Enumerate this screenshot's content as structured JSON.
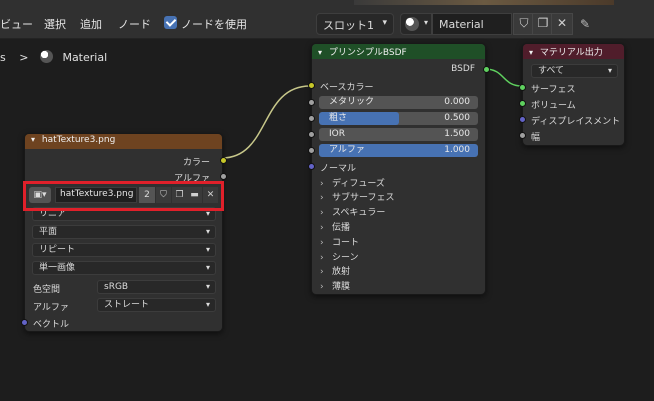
{
  "menu": {
    "view": "ビュー",
    "select": "選択",
    "add": "追加",
    "node": "ノード",
    "use_nodes": "ノードを使用"
  },
  "header": {
    "slot": "スロット1",
    "material_name": "Material",
    "icons": [
      "shield-icon",
      "duplicate-icon",
      "close-icon",
      "pin-icon"
    ]
  },
  "breadcrumb": {
    "prefix": "s",
    "separator": ">",
    "material": "Material"
  },
  "image_node": {
    "title": "hatTexture3.png",
    "outputs": [
      "カラー",
      "アルファ"
    ],
    "image": {
      "name": "hatTexture3.png",
      "users": "2"
    },
    "interpolation": "リニア",
    "projection": "平面",
    "extension": "リピート",
    "source": "単一画像",
    "color_space_label": "色空間",
    "color_space": "sRGB",
    "alpha_label": "アルファ",
    "alpha": "ストレート",
    "vector_label": "ベクトル"
  },
  "bsdf_node": {
    "title": "プリンシプルBSDF",
    "output": "BSDF",
    "base_color": "ベースカラー",
    "fields": [
      {
        "label": "メタリック",
        "value": "0.000",
        "fill": 0
      },
      {
        "label": "粗さ",
        "value": "0.500",
        "fill": 0.5
      },
      {
        "label": "IOR",
        "value": "1.500",
        "fill": 0
      },
      {
        "label": "アルファ",
        "value": "1.000",
        "fill": 1
      }
    ],
    "normal": "ノーマル",
    "panels": [
      "ディフューズ",
      "サブサーフェス",
      "スペキュラー",
      "伝播",
      "コート",
      "シーン",
      "放射",
      "薄膜"
    ]
  },
  "output_node": {
    "title": "マテリアル出力",
    "target": "すべて",
    "inputs": [
      "サーフェス",
      "ボリューム",
      "ディスプレイスメント",
      "幅"
    ]
  },
  "colors": {
    "image_header": "#6e4320",
    "bsdf_header": "#1f4f27",
    "output_header": "#501d2b",
    "accent": "#4772b3"
  }
}
